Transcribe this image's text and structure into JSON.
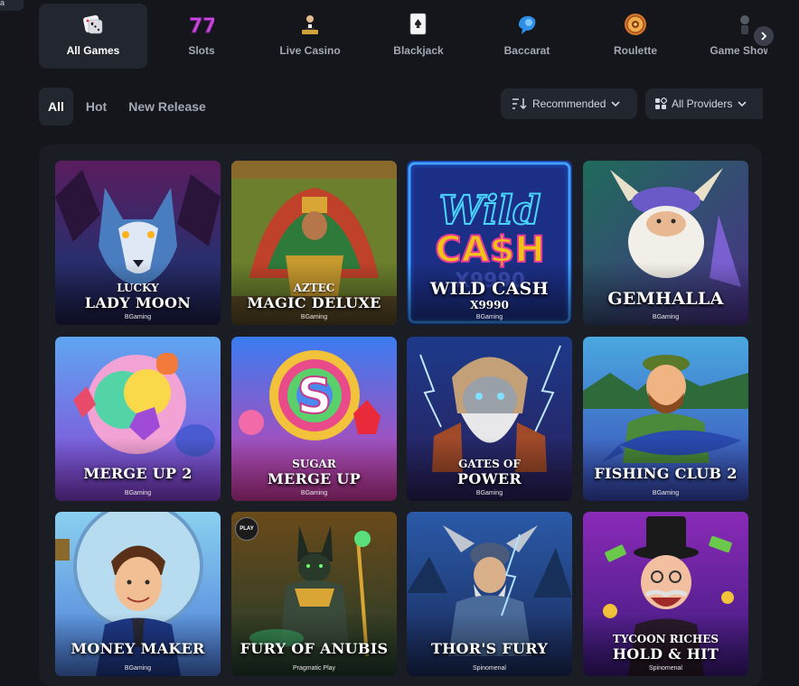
{
  "corner_label": "a",
  "categories": [
    {
      "label": "All Games",
      "icon": "dice-icon",
      "active": true
    },
    {
      "label": "Slots",
      "icon": "slots-777-icon",
      "active": false
    },
    {
      "label": "Live Casino",
      "icon": "live-dealer-icon",
      "active": false
    },
    {
      "label": "Blackjack",
      "icon": "playing-card-icon",
      "active": false
    },
    {
      "label": "Baccarat",
      "icon": "baccarat-chip-icon",
      "active": false
    },
    {
      "label": "Roulette",
      "icon": "roulette-wheel-icon",
      "active": false
    },
    {
      "label": "Game Shows",
      "icon": "game-show-icon",
      "active": false
    }
  ],
  "filter_tabs": [
    {
      "label": "All",
      "active": true
    },
    {
      "label": "Hot",
      "active": false
    },
    {
      "label": "New Release",
      "active": false
    }
  ],
  "sort": {
    "label": "Recommended",
    "icon": "sort-icon"
  },
  "providers": {
    "label": "All Providers",
    "icon": "providers-icon"
  },
  "games": [
    {
      "sub": "LUCKY",
      "name": "LADY MOON",
      "provider": "BGaming"
    },
    {
      "sub": "AZTEC",
      "name": "MAGIC DELUXE",
      "provider": "BGaming"
    },
    {
      "sub": "X9990",
      "name": "WILD CASH",
      "provider": "BGaming"
    },
    {
      "sub": "",
      "name": "GEMHALLA",
      "provider": "BGaming"
    },
    {
      "sub": "",
      "name": "MERGE UP 2",
      "provider": "BGaming"
    },
    {
      "sub": "SUGAR",
      "name": "MERGE UP",
      "provider": "BGaming"
    },
    {
      "sub": "GATES OF",
      "name": "POWER",
      "provider": "BGaming"
    },
    {
      "sub": "",
      "name": "FISHING CLUB 2",
      "provider": "BGaming"
    },
    {
      "sub": "",
      "name": "MONEY MAKER",
      "provider": "BGaming"
    },
    {
      "sub": "",
      "name": "FURY OF ANUBIS",
      "provider": "Pragmatic Play",
      "badge": "PLAY"
    },
    {
      "sub": "",
      "name": "THOR'S FURY",
      "provider": "Spinomenal"
    },
    {
      "sub": "TYCOON RICHES",
      "name": "HOLD & HIT",
      "provider": "Spinomenal"
    }
  ]
}
